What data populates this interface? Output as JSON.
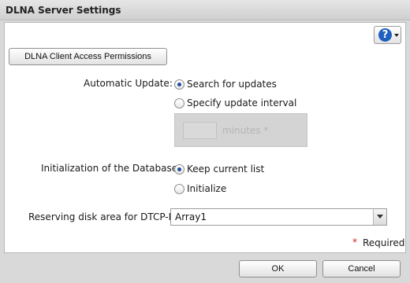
{
  "dialog": {
    "title": "DLNA Server Settings"
  },
  "help": {
    "icon_glyph": "?",
    "icon": "help-question-icon",
    "color": "#1f5fc0"
  },
  "permissions_button": {
    "label": "DLNA Client Access Permissions"
  },
  "automatic_update": {
    "label": "Automatic Update:",
    "options": [
      {
        "label": "Search for updates",
        "checked": true
      },
      {
        "label": "Specify update interval",
        "checked": false
      }
    ],
    "interval_input_value": "",
    "interval_unit_label": "minutes *"
  },
  "database_init": {
    "label": "Initialization of the Database:",
    "options": [
      {
        "label": "Keep current list",
        "checked": true
      },
      {
        "label": "Initialize",
        "checked": false
      }
    ]
  },
  "dtcp": {
    "label": "Reserving disk area for DTCP-IP:",
    "selected": "Array1"
  },
  "required_note": {
    "star": "*",
    "label": "Required",
    "star_color": "#d61b1b"
  },
  "footer": {
    "ok_label": "OK",
    "cancel_label": "Cancel"
  }
}
